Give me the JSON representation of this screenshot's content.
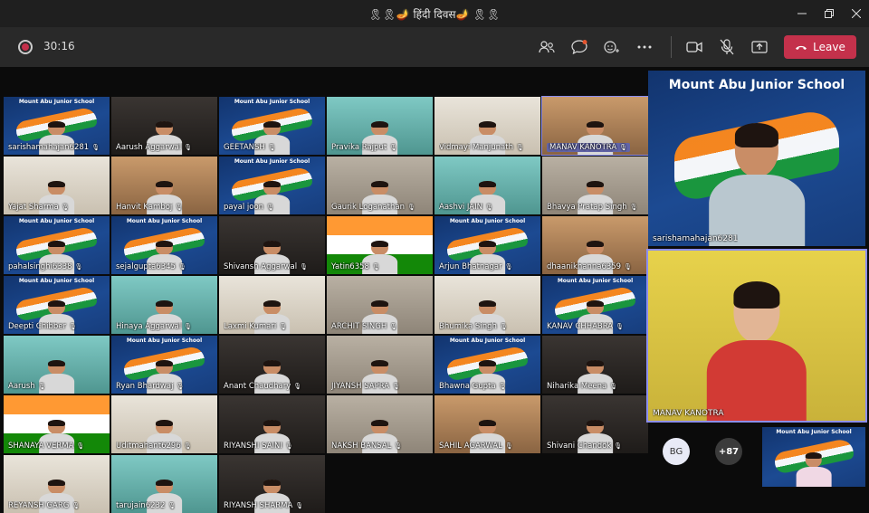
{
  "window": {
    "title": "🎗🎗🪔 हिंदी दिवस🪔 🎗🎗",
    "minimize_icon": "minimize-icon",
    "restore_icon": "restore-icon",
    "close_icon": "close-icon"
  },
  "toolbar": {
    "timer": "30:16",
    "leave_label": "Leave",
    "icons": [
      "participants-icon",
      "chat-icon",
      "reactions-icon",
      "more-icon",
      "camera-icon",
      "mic-off-icon",
      "share-icon",
      "phone-icon"
    ]
  },
  "colors": {
    "leave": "#c4314b",
    "highlight": "#6264a7",
    "titlebar": "#1f1f1f",
    "toolbar": "#292929"
  },
  "grid_tiles": [
    {
      "name": "sarishamahajan6281",
      "style": "school",
      "school_label": "Mount Abu Junior School"
    },
    {
      "name": "Aarush Aggarwal",
      "style": "dark"
    },
    {
      "name": "GEETANSH",
      "style": "school",
      "school_label": "Mount Abu Junior School"
    },
    {
      "name": "Pravika Rajput",
      "style": "teal"
    },
    {
      "name": "Vidmayi Manjunath",
      "style": "light"
    },
    {
      "name": "MANAV KANOTRA",
      "style": "warm",
      "highlight": true
    },
    {
      "name": "Yajat Sharma",
      "style": "light"
    },
    {
      "name": "Hanvit Kamboj",
      "style": "warm"
    },
    {
      "name": "payal joon",
      "style": "school",
      "school_label": "Mount Abu Junior School"
    },
    {
      "name": "Gaurik Loganathan",
      "style": "room"
    },
    {
      "name": "Aashvi JAIN",
      "style": "teal"
    },
    {
      "name": "Bhavya Pratap Singh",
      "style": "room"
    },
    {
      "name": "pahalsinghi6338",
      "style": "school",
      "school_label": "Mount Abu Junior School"
    },
    {
      "name": "sejalgupta6345",
      "style": "school",
      "school_label": "Mount Abu Junior School"
    },
    {
      "name": "Shivansh Aggarwal",
      "style": "dark"
    },
    {
      "name": "Yatin6358",
      "style": "flag"
    },
    {
      "name": "Arjun Bhatnagar",
      "style": "school",
      "school_label": "Mount Abu Junior School"
    },
    {
      "name": "dhaanikhanna6359",
      "style": "warm"
    },
    {
      "name": "Deepti Chibber",
      "style": "school",
      "school_label": "Mount Abu Junior School"
    },
    {
      "name": "Hinaya Aggarwal",
      "style": "teal"
    },
    {
      "name": "Laxmi Kumari",
      "style": "light"
    },
    {
      "name": "ARCHIT SINGH",
      "style": "room"
    },
    {
      "name": "Bhumika Singh",
      "style": "light"
    },
    {
      "name": "KANAV CHHABRA",
      "style": "school",
      "school_label": "Mount Abu Junior School"
    },
    {
      "name": "Aarush",
      "style": "teal"
    },
    {
      "name": "Ryan Bhardwaj",
      "style": "school",
      "school_label": "Mount Abu Junior School"
    },
    {
      "name": "Anant Chaudhary",
      "style": "dark"
    },
    {
      "name": "JIYANSH SAPRA",
      "style": "room"
    },
    {
      "name": "Bhawna Gupta",
      "style": "school",
      "school_label": "Mount Abu Junior School"
    },
    {
      "name": "Niharika Meena",
      "style": "dark"
    },
    {
      "name": "SHANAYA VERMA",
      "style": "flag"
    },
    {
      "name": "Uditmahant6296",
      "style": "light"
    },
    {
      "name": "RIYANSHI SAINI",
      "style": "dark"
    },
    {
      "name": "NAKSH BANSAL",
      "style": "room"
    },
    {
      "name": "SAHIL AGARWAL",
      "style": "warm"
    },
    {
      "name": "Shivani Chandok",
      "style": "dark"
    },
    {
      "name": "REYANSH GARG",
      "style": "light"
    },
    {
      "name": "tarujain6232",
      "style": "teal"
    },
    {
      "name": "RIYANSH SHARMA",
      "style": "dark"
    }
  ],
  "spotlight": [
    {
      "name": "sarishamahajan6281",
      "school_label": "Mount Abu Junior School"
    },
    {
      "name": "MANAV KANOTRA"
    }
  ],
  "overflow": {
    "avatar_initials": "BG",
    "more_count": "+87",
    "preview_label": "Mount Abu Junior School"
  }
}
